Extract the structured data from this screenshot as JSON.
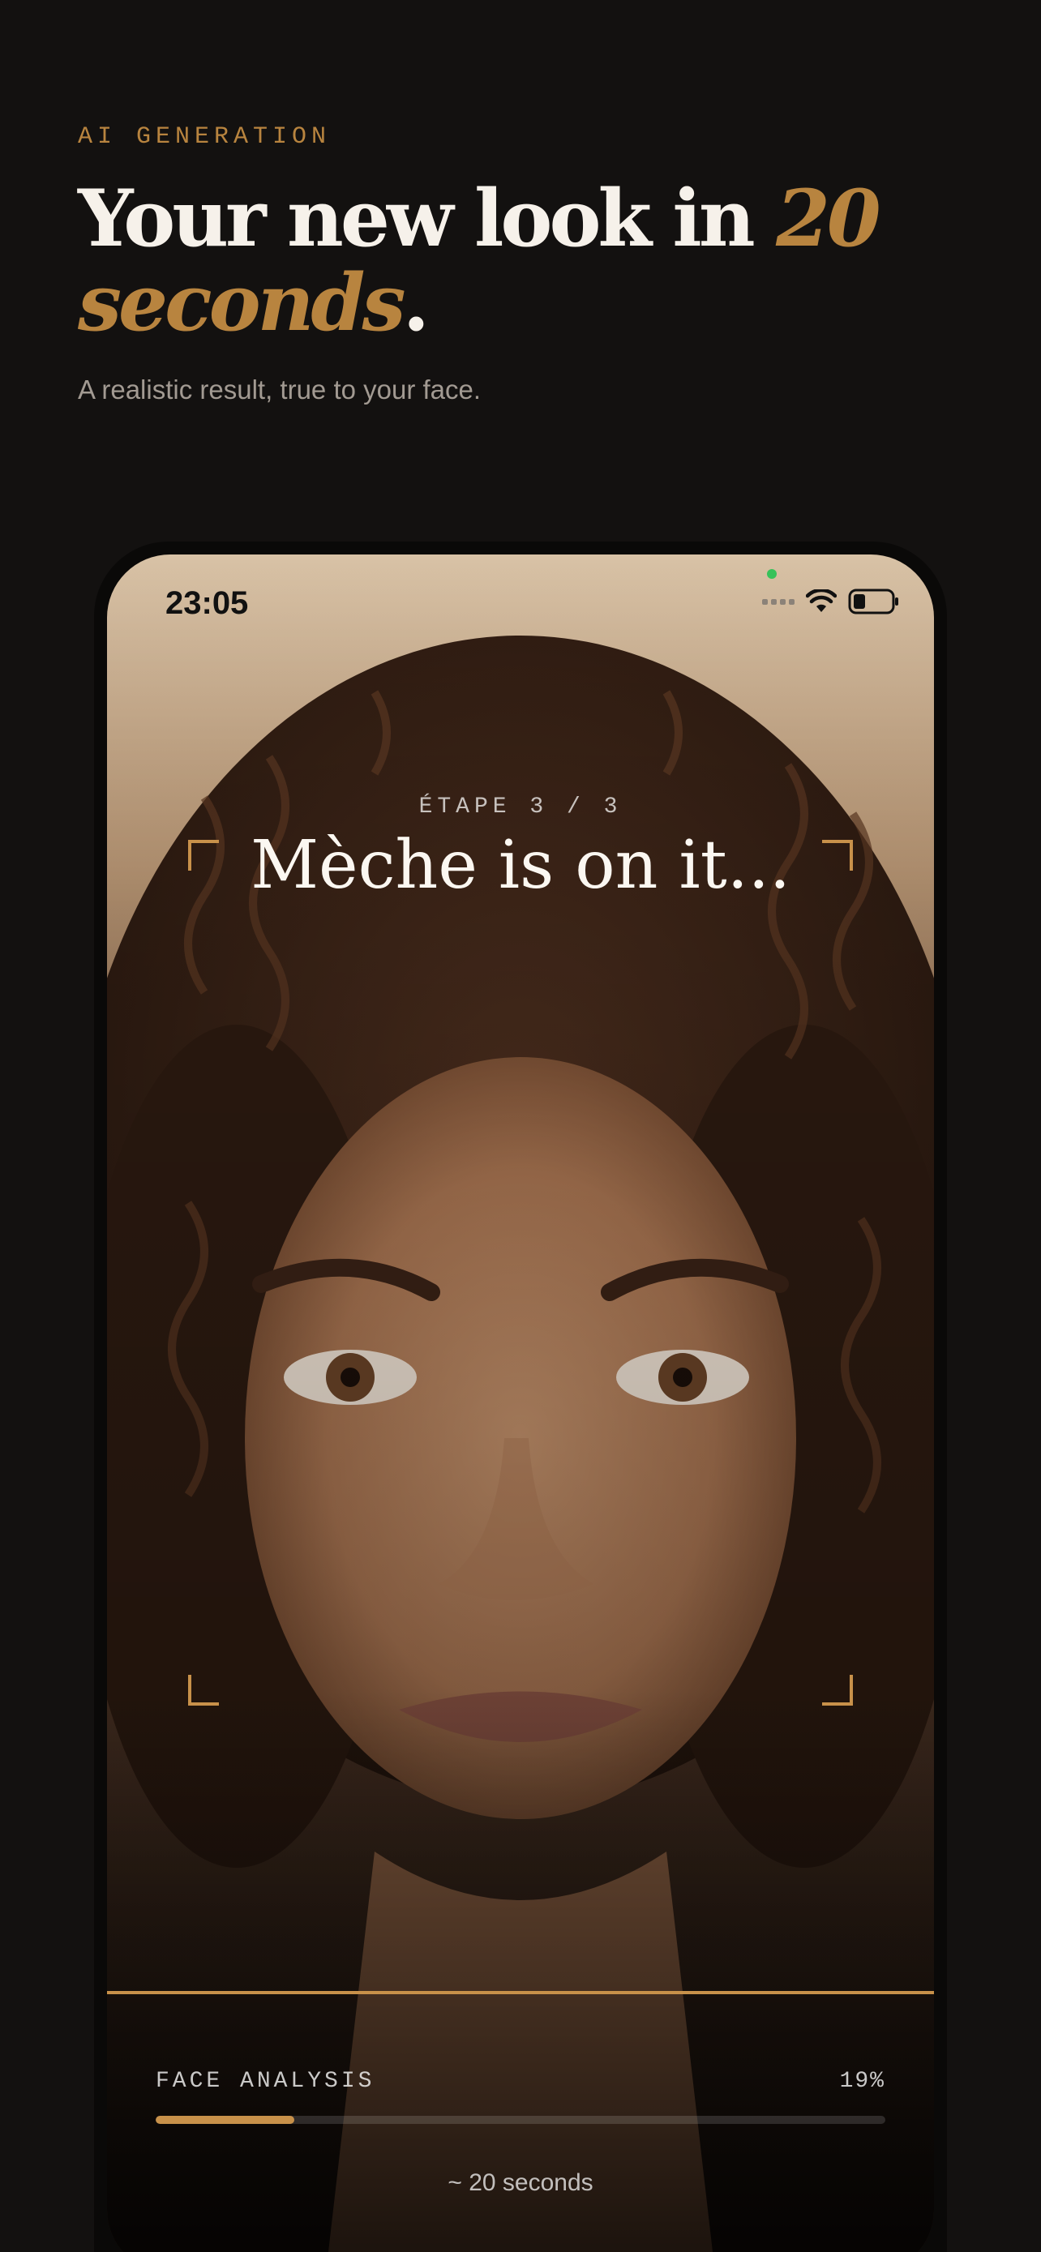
{
  "intro": {
    "eyebrow": "AI GENERATION",
    "headline_main": "Your new look in ",
    "headline_accent_1": "20",
    "headline_accent_2": "seconds",
    "headline_end": ".",
    "subtitle": "A realistic result, true to your face."
  },
  "status_bar": {
    "time": "23:05",
    "icons": [
      "cellular-signal-icon",
      "wifi-icon",
      "battery-icon"
    ]
  },
  "generation": {
    "step": "ÉTAPE 3 / 3",
    "title": "Mèche is on it...",
    "phase_label": "FACE ANALYSIS",
    "progress_text": "19%",
    "progress": 0.19,
    "eta": "~ 20 seconds"
  },
  "colors": {
    "background": "#131110",
    "accent": "#b8843f",
    "scan_accent": "#c8914a"
  }
}
